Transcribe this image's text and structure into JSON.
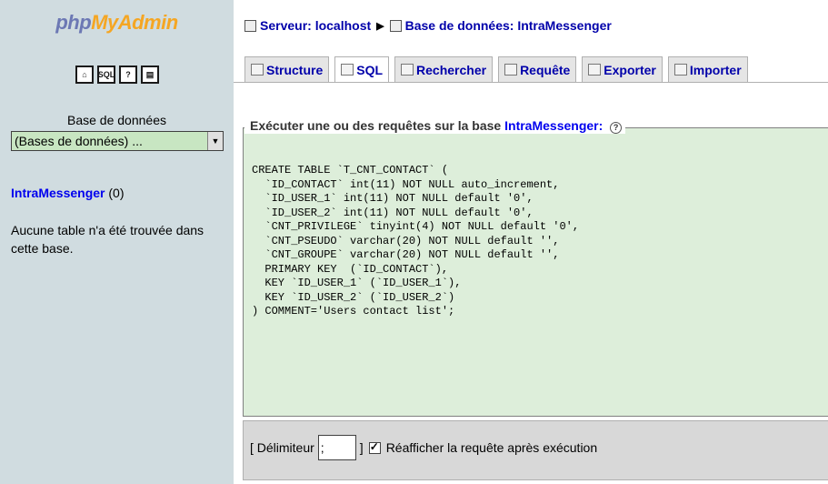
{
  "sidebar": {
    "logo_php": "php",
    "logo_myadmin": "MyAdmin",
    "icons": [
      "home-icon",
      "sql-icon",
      "help-icon",
      "query-window-icon"
    ],
    "db_label": "Base de données",
    "db_select_value": "(Bases de données) ...",
    "db_link": "IntraMessenger",
    "db_count": "(0)",
    "no_tables": "Aucune table n'a été trouvée dans cette base."
  },
  "breadcrumb": {
    "server": "Serveur: localhost",
    "database": "Base de données: IntraMessenger"
  },
  "tabs": [
    {
      "label": "Structure",
      "active": false
    },
    {
      "label": "SQL",
      "active": true
    },
    {
      "label": "Rechercher",
      "active": false
    },
    {
      "label": "Requête",
      "active": false
    },
    {
      "label": "Exporter",
      "active": false
    },
    {
      "label": "Importer",
      "active": false
    }
  ],
  "query": {
    "legend_prefix": "Exécuter une ou des requêtes sur la base",
    "legend_db": "IntraMessenger:",
    "sql": "CREATE TABLE `T_CNT_CONTACT` (\n  `ID_CONTACT` int(11) NOT NULL auto_increment,\n  `ID_USER_1` int(11) NOT NULL default '0',\n  `ID_USER_2` int(11) NOT NULL default '0',\n  `CNT_PRIVILEGE` tinyint(4) NOT NULL default '0',\n  `CNT_PSEUDO` varchar(20) NOT NULL default '',\n  `CNT_GROUPE` varchar(20) NOT NULL default '',\n  PRIMARY KEY  (`ID_CONTACT`),\n  KEY `ID_USER_1` (`ID_USER_1`),\n  KEY `ID_USER_2` (`ID_USER_2`)\n) COMMENT='Users contact list';",
    "delimiter_label": "[ Délimiteur",
    "delimiter_value": ";",
    "delimiter_close": "]",
    "reshow_label": "Réafficher la requête après exécution"
  },
  "colors": {
    "sidebar_bg": "#d0dce0",
    "editor_bg": "#ddeeda",
    "link": "#0000ee"
  }
}
